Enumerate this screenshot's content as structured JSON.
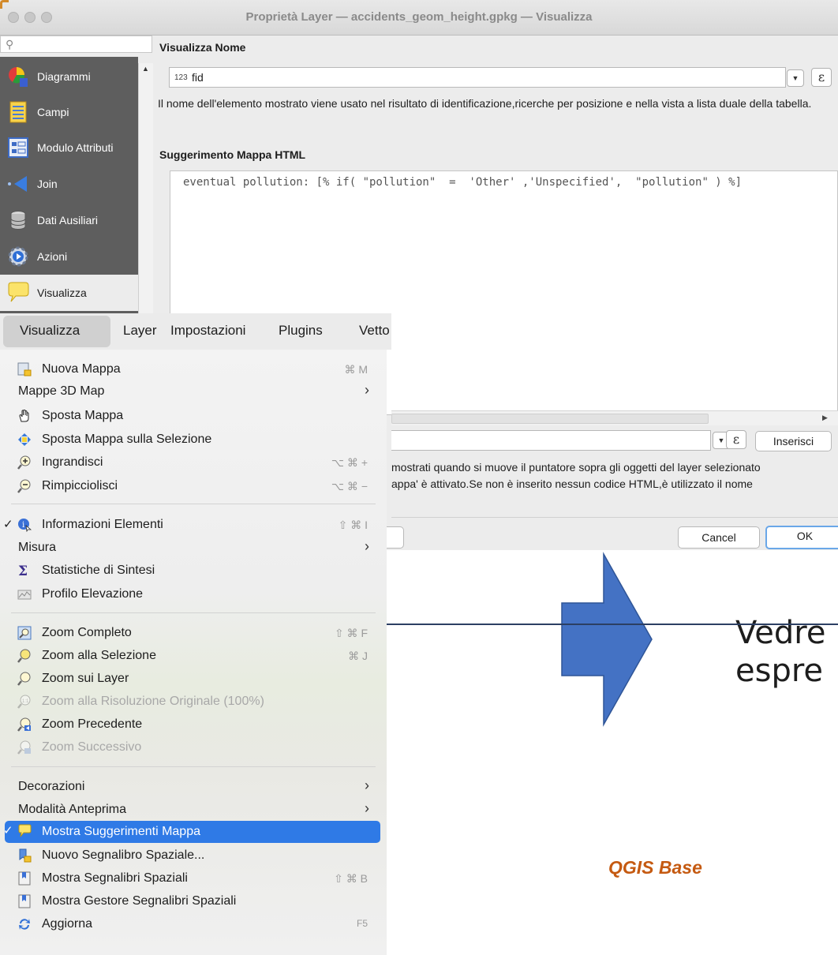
{
  "window": {
    "title": "Proprietà Layer — accidents_geom_height.gpkg — Visualizza"
  },
  "sidebar": {
    "search_placeholder": "",
    "items": [
      {
        "label": "Diagrammi"
      },
      {
        "label": "Campi"
      },
      {
        "label": "Modulo Attributi"
      },
      {
        "label": "Join"
      },
      {
        "label": "Dati Ausiliari"
      },
      {
        "label": "Azioni"
      },
      {
        "label": "Visualizza"
      }
    ]
  },
  "display_name": {
    "section_title": "Visualizza Nome",
    "field_type_badge": "123",
    "field_value": "fid",
    "description": "Il nome dell'elemento mostrato viene usato nel risultato di identificazione,ricerche per posizione e nella vista a lista duale della tabella."
  },
  "html_tips": {
    "section_title": "Suggerimento Mappa HTML",
    "code": "eventual pollution: [% if( \"pollution\"  =  'Other' ,'Unspecified',  \"pollution\" ) %]",
    "insert_label": "Inserisci",
    "help_line1": "mostrati quando si muove il puntatore sopra gli oggetti del layer selezionato",
    "help_line2": "appa' è attivato.Se non è inserito nessun codice HTML,è utilizzato il nome"
  },
  "epsilon_symbol": "ε",
  "buttons": {
    "cancel": "Cancel",
    "ok": "OK"
  },
  "menubar": {
    "items": [
      "Visualizza",
      "Layer",
      "Impostazioni",
      "Plugins",
      "Vetto"
    ]
  },
  "menu": {
    "items": [
      {
        "label": "Nuova Mappa",
        "shortcut": "⌘ M",
        "icon": "new-map-icon"
      },
      {
        "label": "Mappe 3D Map",
        "submenu": "›"
      },
      {
        "label": "Sposta Mappa",
        "icon": "pan-hand-icon"
      },
      {
        "label": "Sposta Mappa sulla Selezione",
        "icon": "pan-to-selection-icon"
      },
      {
        "label": "Ingrandisci",
        "shortcut": "⌥ ⌘ +",
        "icon": "zoom-in-icon"
      },
      {
        "label": "Rimpicciolisci",
        "shortcut": "⌥ ⌘ −",
        "icon": "zoom-out-icon"
      },
      {
        "label": "Informazioni Elementi",
        "shortcut": "⇧ ⌘ I",
        "icon": "identify-icon",
        "checked": "✓"
      },
      {
        "label": "Misura",
        "submenu": "›"
      },
      {
        "label": "Statistiche di Sintesi",
        "icon": "sigma-icon"
      },
      {
        "label": "Profilo Elevazione",
        "icon": "elevation-profile-icon"
      },
      {
        "label": "Zoom Completo",
        "shortcut": "⇧ ⌘ F",
        "icon": "zoom-full-icon"
      },
      {
        "label": "Zoom alla Selezione",
        "shortcut": "⌘ J",
        "icon": "zoom-selection-icon"
      },
      {
        "label": "Zoom sui Layer",
        "icon": "zoom-layer-icon"
      },
      {
        "label": "Zoom alla Risoluzione Originale (100%)",
        "icon": "zoom-actual-icon"
      },
      {
        "label": "Zoom Precedente",
        "icon": "zoom-last-icon"
      },
      {
        "label": "Zoom Successivo",
        "icon": "zoom-next-icon"
      },
      {
        "label": "Decorazioni",
        "submenu": "›"
      },
      {
        "label": "Modalità Anteprima",
        "submenu": "›"
      },
      {
        "label": "Mostra Suggerimenti Mappa",
        "icon": "map-tips-icon",
        "checked": "✓"
      },
      {
        "label": "Nuovo Segnalibro Spaziale...",
        "icon": "new-bookmark-icon"
      },
      {
        "label": "Mostra Segnalibri Spaziali",
        "shortcut": "⇧ ⌘ B",
        "icon": "bookmarks-icon"
      },
      {
        "label": "Mostra Gestore Segnalibri Spaziali",
        "icon": "bookmark-manager-icon"
      },
      {
        "label": "Aggiorna",
        "shortcut": "F5",
        "icon": "refresh-icon"
      }
    ]
  },
  "slide": {
    "text_line1": "Vedre",
    "text_line2": "espre",
    "footer": "QGIS Base",
    "arrow_color": "#4472c4",
    "line_color": "#2c3f63",
    "footer_color": "#c55a11"
  }
}
